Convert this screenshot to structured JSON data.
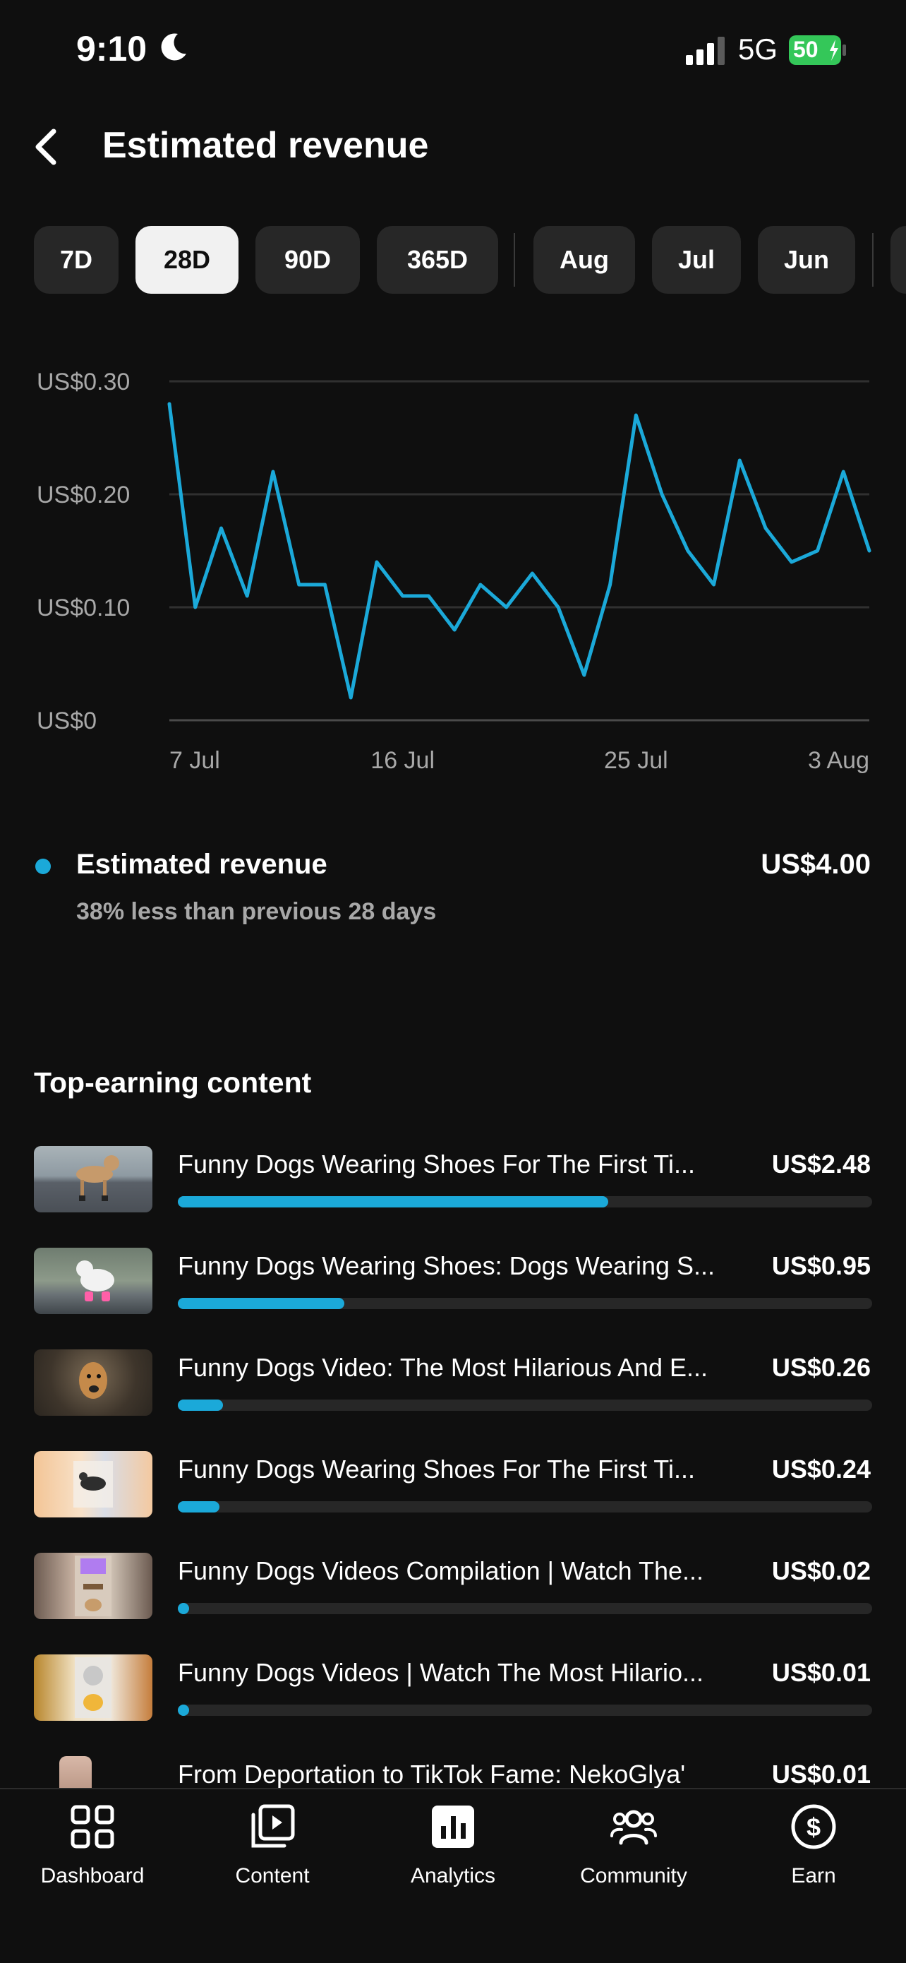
{
  "status_bar": {
    "time": "9:10",
    "network": "5G",
    "battery": "50",
    "icons": [
      "moon-icon",
      "signal-icon",
      "battery-charging-icon"
    ]
  },
  "header": {
    "title": "Estimated revenue",
    "back_icon": "chevron-left-icon"
  },
  "periods": [
    {
      "label": "7D",
      "selected": false
    },
    {
      "label": "28D",
      "selected": true
    },
    {
      "label": "90D",
      "selected": false
    },
    {
      "label": "365D",
      "selected": false
    },
    {
      "label": "Aug",
      "selected": false
    },
    {
      "label": "Jul",
      "selected": false
    },
    {
      "label": "Jun",
      "selected": false
    }
  ],
  "chart_data": {
    "type": "line",
    "title": "",
    "xlabel": "",
    "ylabel": "",
    "y_tick_labels": [
      "US$0.30",
      "US$0.20",
      "US$0.10",
      "US$0"
    ],
    "y_ticks": [
      0.3,
      0.2,
      0.1,
      0
    ],
    "x_tick_labels": [
      "7 Jul",
      "16 Jul",
      "25 Jul",
      "3 Aug"
    ],
    "ylim": [
      0,
      0.3
    ],
    "grid": true,
    "line_color": "#1ba9d9",
    "x": [
      "7 Jul",
      "8 Jul",
      "9 Jul",
      "10 Jul",
      "11 Jul",
      "12 Jul",
      "13 Jul",
      "14 Jul",
      "15 Jul",
      "16 Jul",
      "17 Jul",
      "18 Jul",
      "19 Jul",
      "20 Jul",
      "21 Jul",
      "22 Jul",
      "23 Jul",
      "24 Jul",
      "25 Jul",
      "26 Jul",
      "27 Jul",
      "28 Jul",
      "29 Jul",
      "30 Jul",
      "31 Jul",
      "1 Aug",
      "2 Aug",
      "3 Aug"
    ],
    "series": [
      {
        "values": [
          0.28,
          0.1,
          0.17,
          0.11,
          0.22,
          0.12,
          0.12,
          0.02,
          0.14,
          0.11,
          0.11,
          0.08,
          0.12,
          0.1,
          0.13,
          0.1,
          0.04,
          0.12,
          0.27,
          0.2,
          0.15,
          0.12,
          0.23,
          0.17,
          0.14,
          0.15,
          0.22,
          0.15
        ]
      }
    ]
  },
  "summary": {
    "label": "Estimated revenue",
    "value": "US$4.00",
    "comparison": "38% less than previous 28 days",
    "dot_color": "#1ba9d9"
  },
  "top_content": {
    "title": "Top-earning content",
    "items": [
      {
        "title": "Funny Dogs Wearing Shoes For The First Ti...",
        "value": "US$2.48",
        "share": 0.62
      },
      {
        "title": "Funny Dogs Wearing Shoes: Dogs Wearing S...",
        "value": "US$0.95",
        "share": 0.24
      },
      {
        "title": "Funny Dogs Video: The Most Hilarious And E...",
        "value": "US$0.26",
        "share": 0.065
      },
      {
        "title": "Funny Dogs Wearing Shoes For The First Ti...",
        "value": "US$0.24",
        "share": 0.06
      },
      {
        "title": "Funny Dogs Videos Compilation | Watch The...",
        "value": "US$0.02",
        "share": 0.005
      },
      {
        "title": "Funny Dogs Videos | Watch The Most Hilario...",
        "value": "US$0.01",
        "share": 0.003
      },
      {
        "title": "From Deportation to TikTok Fame: NekoGlya'",
        "value": "US$0.01",
        "share": 0.003
      }
    ]
  },
  "bottom_nav": [
    {
      "label": "Dashboard",
      "icon": "dashboard-icon"
    },
    {
      "label": "Content",
      "icon": "content-icon"
    },
    {
      "label": "Analytics",
      "icon": "analytics-icon"
    },
    {
      "label": "Community",
      "icon": "community-icon"
    },
    {
      "label": "Earn",
      "icon": "earn-icon"
    }
  ]
}
